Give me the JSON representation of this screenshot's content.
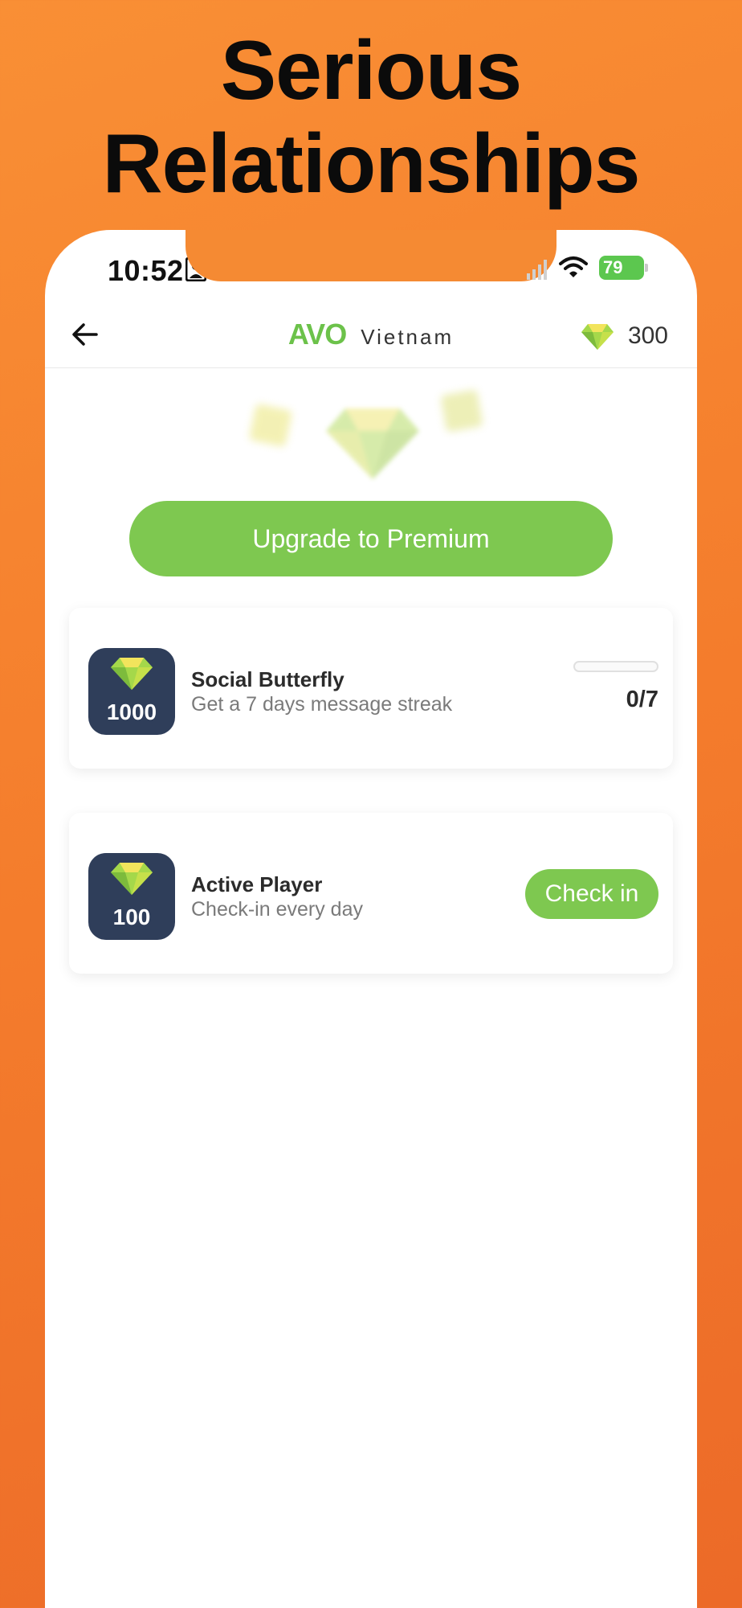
{
  "promo": {
    "headline_line1": "Serious",
    "headline_line2": "Relationships"
  },
  "status_bar": {
    "time": "10:52",
    "battery": "79"
  },
  "header": {
    "brand_primary": "AVO",
    "brand_secondary": "Vietnam",
    "coin_balance": "300",
    "coin_icon": "gem-icon",
    "back_icon": "arrow-left-icon"
  },
  "upgrade": {
    "label": "Upgrade to Premium"
  },
  "tasks": [
    {
      "reward": "1000",
      "title": "Social Butterfly",
      "description": "Get a 7 days message streak",
      "progress_text": "0/7",
      "progress_fraction": 0
    },
    {
      "reward": "100",
      "title": "Active Player",
      "description": "Check-in every day",
      "action_label": "Check in"
    }
  ],
  "colors": {
    "background_orange": "#f58a33",
    "accent_green": "#7ec850",
    "badge_navy": "#2f3e5a"
  }
}
